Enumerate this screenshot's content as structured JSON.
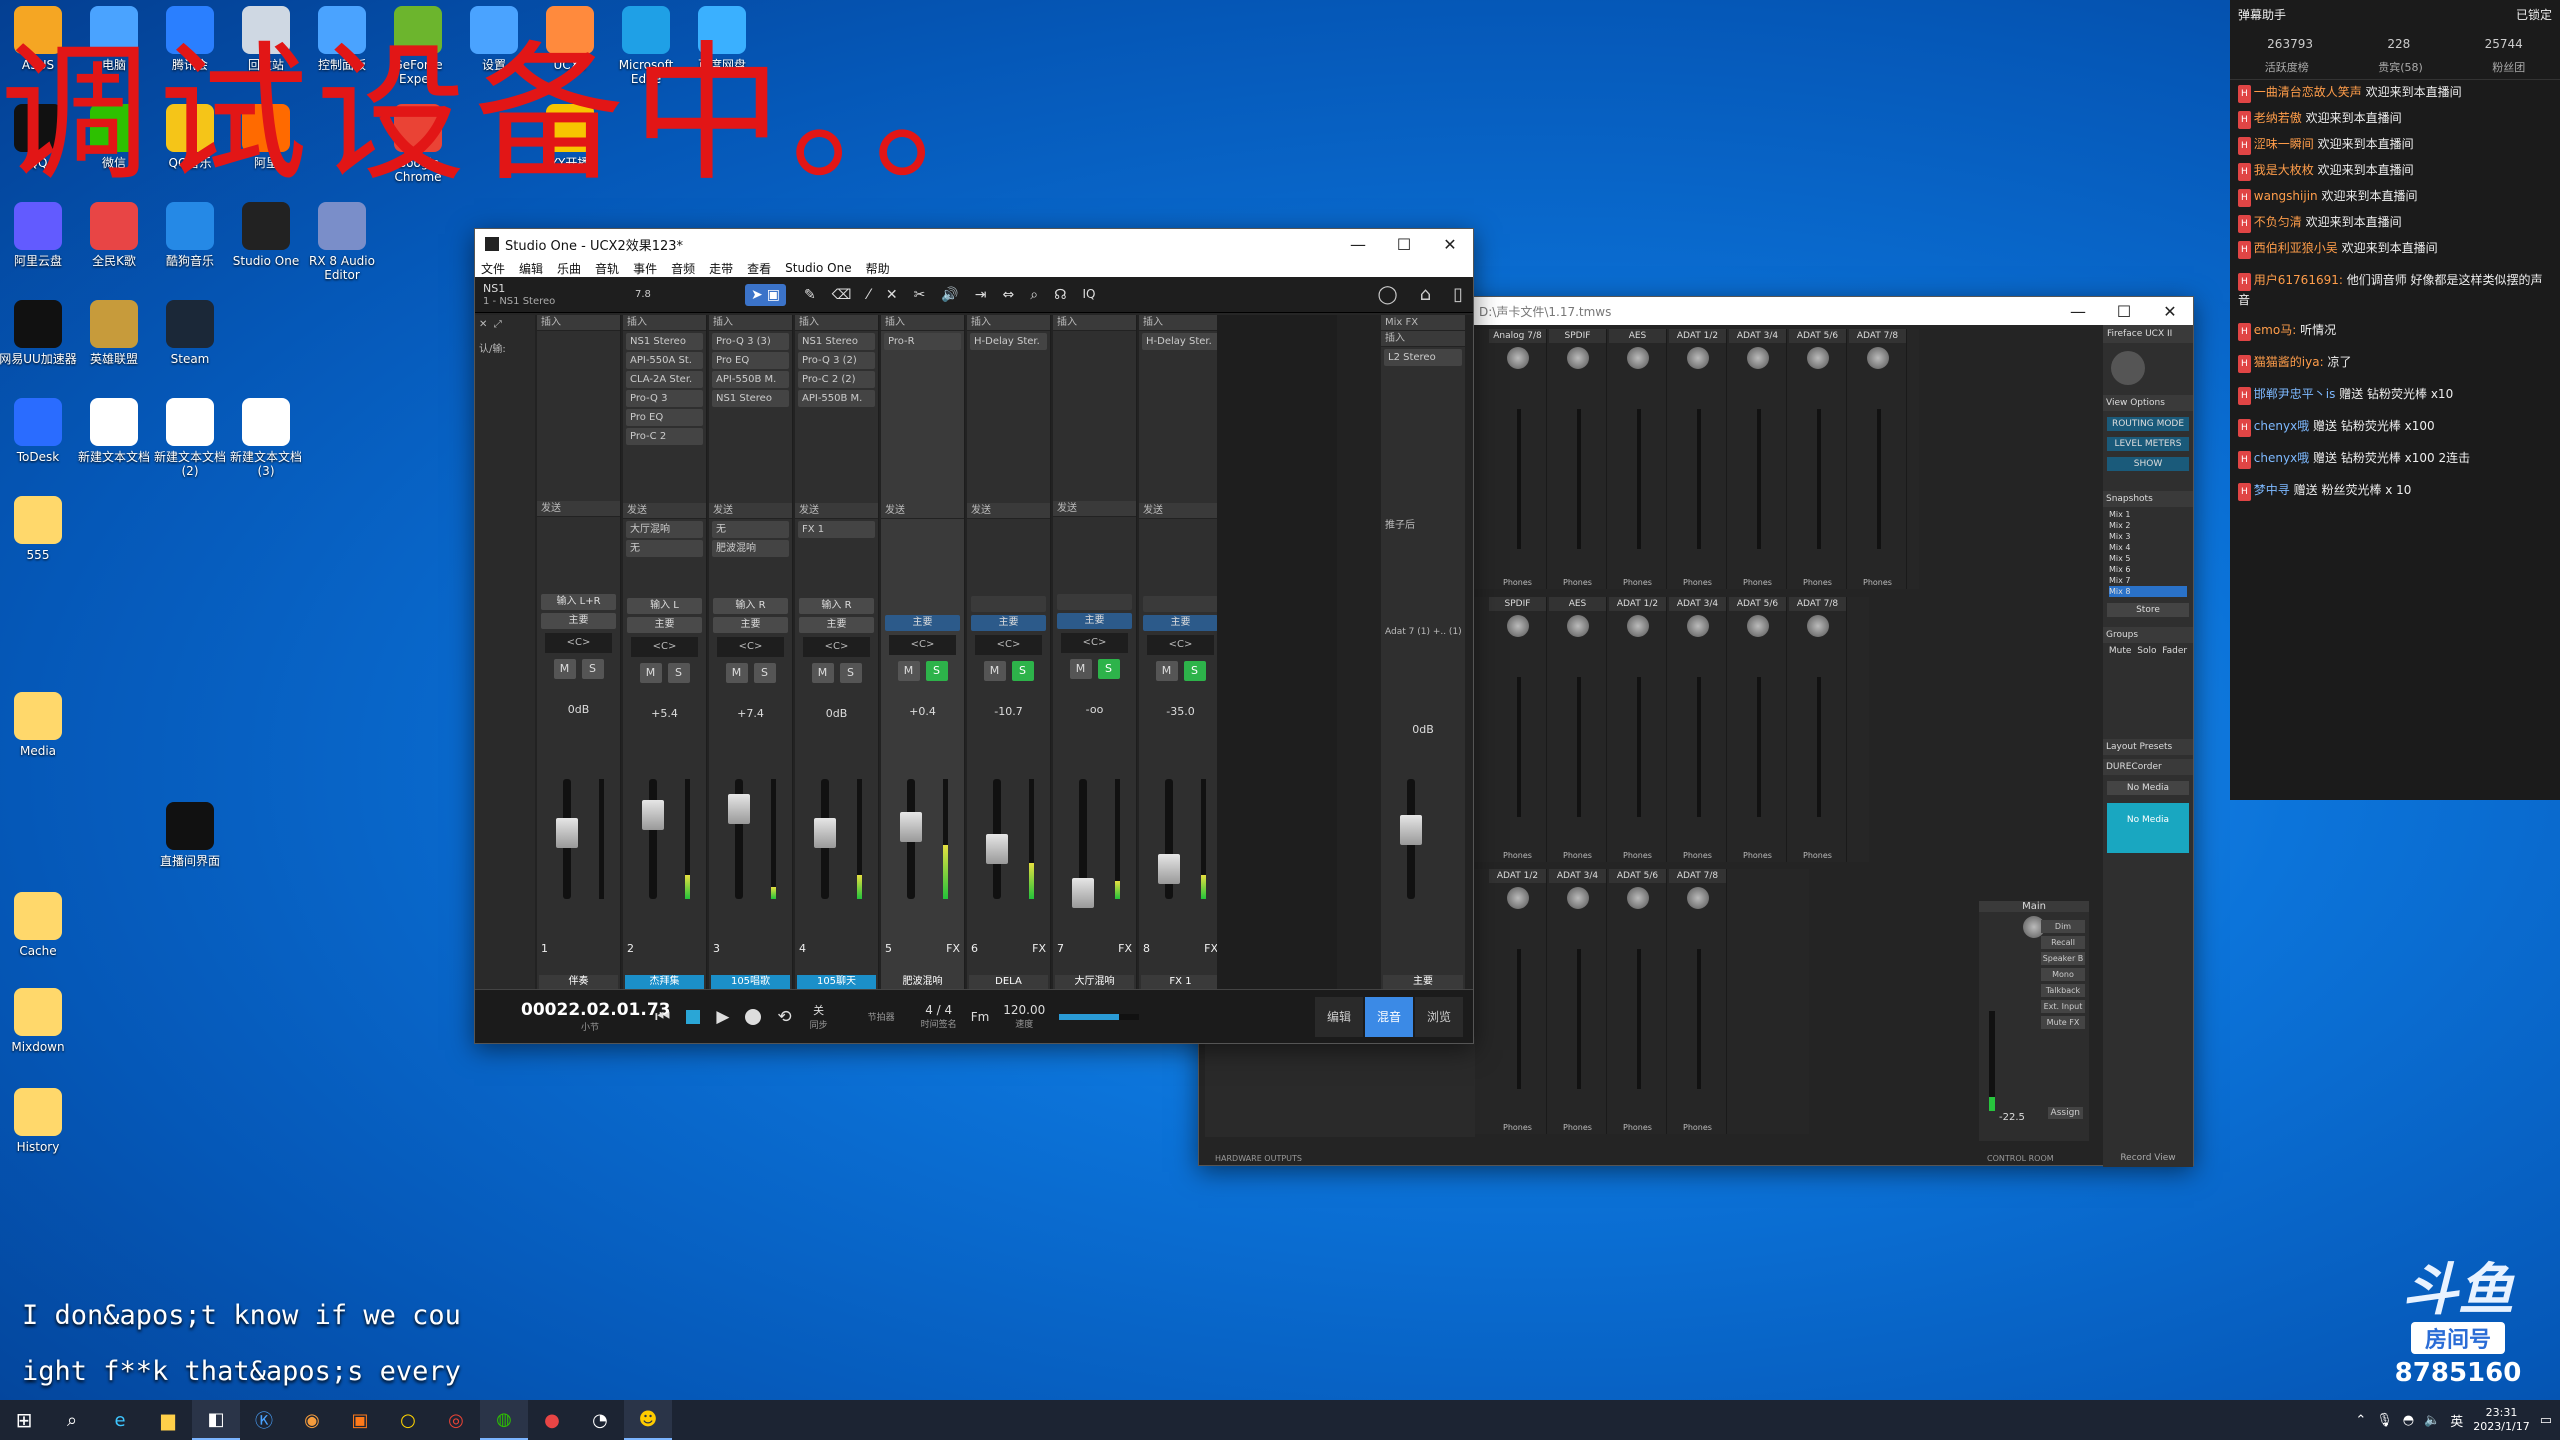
{
  "overlay_title": "调试设备中。。",
  "desktop_icons": [
    {
      "label": "ASUS",
      "icon": "person-icon",
      "color": "#f5a623"
    },
    {
      "label": "电脑",
      "icon": "computer-icon",
      "color": "#4aa3ff"
    },
    {
      "label": "腾讯会",
      "icon": "meeting-icon",
      "color": "#2a7fff"
    },
    {
      "label": "回收站",
      "icon": "recycle-bin-icon",
      "color": "#cfd8e3"
    },
    {
      "label": "控制面板",
      "icon": "control-panel-icon",
      "color": "#4aa3ff"
    },
    {
      "label": "GeForce Experi",
      "icon": "nvidia-icon",
      "color": "#6cb52d"
    },
    {
      "label": "设置",
      "icon": "gear-icon",
      "color": "#4aa3ff"
    },
    {
      "label": "UCX2",
      "icon": "app-icon",
      "color": "#ff8a3d"
    },
    {
      "label": "Microsoft Edge",
      "icon": "edge-icon",
      "color": "#1fa0e6"
    },
    {
      "label": "百度网盘",
      "icon": "cloud-icon",
      "color": "#3ab0ff"
    },
    {
      "label": "QQ",
      "icon": "qq-icon",
      "color": "#111"
    },
    {
      "label": "微信",
      "icon": "wechat-icon",
      "color": "#2dc100"
    },
    {
      "label": "QQ音乐",
      "icon": "music-icon",
      "color": "#f5c518"
    },
    {
      "label": "阿里",
      "icon": "app-icon",
      "color": "#ff6a00"
    },
    {
      "label": "Google Chrome",
      "icon": "chrome-icon",
      "color": "#ea4335"
    },
    {
      "label": "YY开播",
      "icon": "yy-icon",
      "color": "#f7c600"
    },
    {
      "label": "阿里云盘",
      "icon": "cloud-icon",
      "color": "#625bff"
    },
    {
      "label": "全民K歌",
      "icon": "karaoke-icon",
      "color": "#e84545"
    },
    {
      "label": "酷狗音乐",
      "icon": "kugou-icon",
      "color": "#2589e6"
    },
    {
      "label": "Studio One",
      "icon": "studio-one-icon",
      "color": "#222"
    },
    {
      "label": "RX 8 Audio Editor",
      "icon": "rx-icon",
      "color": "#7a8ec9"
    },
    {
      "label": "网易UU加速器",
      "icon": "uu-icon",
      "color": "#111"
    },
    {
      "label": "英雄联盟",
      "icon": "lol-icon",
      "color": "#c79b3b"
    },
    {
      "label": "Steam",
      "icon": "steam-icon",
      "color": "#1b2838"
    },
    {
      "label": "ToDesk",
      "icon": "todesk-icon",
      "color": "#2a6cff"
    },
    {
      "label": "新建文本文档",
      "icon": "file-icon",
      "color": "#ffffff"
    },
    {
      "label": "新建文本文档 (2)",
      "icon": "file-icon",
      "color": "#ffffff"
    },
    {
      "label": "新建文本文档 (3)",
      "icon": "file-icon",
      "color": "#ffffff"
    },
    {
      "label": "555",
      "icon": "folder-icon",
      "color": "#ffd86b"
    },
    {
      "label": "Media",
      "icon": "folder-icon",
      "color": "#ffd86b"
    },
    {
      "label": "直播间界面",
      "icon": "window-icon",
      "color": "#111"
    },
    {
      "label": "Cache",
      "icon": "folder-icon",
      "color": "#ffd86b"
    },
    {
      "label": "Mixdown",
      "icon": "folder-icon",
      "color": "#ffd86b"
    },
    {
      "label": "History",
      "icon": "folder-icon",
      "color": "#ffd86b"
    }
  ],
  "studio_one": {
    "title": "Studio One - UCX2效果123*",
    "menu": [
      "文件",
      "编辑",
      "乐曲",
      "音轨",
      "事件",
      "音频",
      "走带",
      "查看",
      "Studio One",
      "帮助"
    ],
    "track_name": "NS1",
    "track_sub": "1 - NS1 Stereo",
    "version_badge": "7.8",
    "tool_label": "IQ",
    "side_labels": {
      "input": "认/输:"
    },
    "insert_label": "插入",
    "send_label": "发送",
    "mixfx_label": "Mix FX",
    "channels": [
      {
        "num": "1",
        "name": "伴奏",
        "input": "输入 L+R",
        "out": "主要",
        "gain": "0dB",
        "inserts": [],
        "sends": [],
        "meter": 0,
        "fader": 0.55,
        "solo": false,
        "fx": ""
      },
      {
        "num": "2",
        "name": "杰拜集",
        "input": "输入 L",
        "out": "主要",
        "gain": "+5.4",
        "inserts": [
          "NS1 Stereo",
          "API-550A St.",
          "CLA-2A Ster.",
          "Pro-Q 3",
          "Pro EQ",
          "Pro-C 2"
        ],
        "sends": [
          "大厅混响",
          "无"
        ],
        "meter": 0.2,
        "fader": 0.7,
        "solo": false,
        "fx": ""
      },
      {
        "num": "3",
        "name": "105唱歌",
        "input": "输入 R",
        "out": "主要",
        "gain": "+7.4",
        "inserts": [
          "Pro-Q 3 (3)",
          "Pro EQ",
          "API-550B M.",
          "NS1 Stereo"
        ],
        "sends": [
          "无",
          "肥波混响"
        ],
        "meter": 0.1,
        "fader": 0.75,
        "solo": false,
        "fx": ""
      },
      {
        "num": "4",
        "name": "105聊天",
        "input": "输入 R",
        "out": "主要",
        "gain": "0dB",
        "inserts": [
          "NS1 Stereo",
          "Pro-Q 3 (2)",
          "Pro-C 2 (2)",
          "API-550B M."
        ],
        "sends": [
          "FX 1"
        ],
        "meter": 0.2,
        "fader": 0.55,
        "solo": false,
        "fx": ""
      },
      {
        "num": "5",
        "name": "肥波混响",
        "input": "",
        "out": "主要",
        "gain": "+0.4",
        "inserts": [
          "Pro-R"
        ],
        "sends": [],
        "meter": 0.45,
        "fader": 0.6,
        "solo": true,
        "fx": "FX"
      },
      {
        "num": "6",
        "name": "DELA",
        "input": "",
        "out": "主要",
        "gain": "-10.7",
        "inserts": [
          "H-Delay Ster."
        ],
        "sends": [],
        "meter": 0.3,
        "fader": 0.42,
        "solo": true,
        "fx": "FX"
      },
      {
        "num": "7",
        "name": "大厅混响",
        "input": "",
        "out": "主要",
        "gain": "-oo",
        "inserts": [],
        "sends": [],
        "meter": 0.15,
        "fader": 0.05,
        "solo": true,
        "fx": "FX"
      },
      {
        "num": "8",
        "name": "FX 1",
        "input": "",
        "out": "主要",
        "gain": "-35.0",
        "inserts": [
          "H-Delay Ster."
        ],
        "sends": [],
        "meter": 0.2,
        "fader": 0.25,
        "solo": true,
        "fx": "FX"
      }
    ],
    "main": {
      "name": "主要",
      "gain": "0dB",
      "insert": "L2 Stereo",
      "label": "Adat 7 (1) +.. (1)",
      "post": "推子后"
    },
    "time": "00022.02.01.73",
    "time_unit": "小节",
    "sync_label": "关",
    "sync_sub": "同步",
    "metronome": "节拍器",
    "signature": "4 / 4",
    "sig_sub": "时间签名",
    "key": "Fm",
    "tempo": "120.00",
    "tempo_sub": "速度",
    "tabs": [
      "编辑",
      "混音",
      "浏览"
    ],
    "active_tab": "混音"
  },
  "universal_control": {
    "title": "D:\\声卡文件\\1.17.tmws",
    "top_cols": [
      "Analog 7/8",
      "SPDIF",
      "AES",
      "ADAT 1/2",
      "ADAT 3/4",
      "ADAT 5/6",
      "ADAT 7/8"
    ],
    "mid_cols": [
      "SPDIF",
      "AES",
      "ADAT 1/2",
      "ADAT 3/4",
      "ADAT 5/6",
      "ADAT 7/8"
    ],
    "bot_cols": [
      "ADAT 1/2",
      "ADAT 3/4",
      "ADAT 5/6",
      "ADAT 7/8"
    ],
    "phones": "Phones",
    "sidebar": {
      "device": "Fireface UCX II",
      "view_options": "View Options",
      "routing_mode": "ROUTING MODE",
      "level_meters": "LEVEL METERS",
      "show": "SHOW",
      "snapshots": "Snapshots",
      "mixes": [
        "Mix 1",
        "Mix 2",
        "Mix 3",
        "Mix 4",
        "Mix 5",
        "Mix 6",
        "Mix 7",
        "Mix 8"
      ],
      "store": "Store",
      "groups": "Groups",
      "groups_head": [
        "Mute",
        "Solo",
        "Fader"
      ],
      "layout_presets": "Layout Presets",
      "durec": "DURECorder",
      "no_media": "No Media",
      "record_view": "Record View"
    },
    "main_ch": {
      "name": "Main",
      "buttons": [
        "Dim",
        "Recall",
        "Speaker B",
        "Mono",
        "Talkback",
        "Ext. Input",
        "Mute FX"
      ],
      "assign": "Assign",
      "level": "-22.5"
    },
    "footer_left": "HARDWARE OUTPUTS",
    "footer_right": "CONTROL ROOM"
  },
  "chat": {
    "header": "弹幕助手",
    "status": "已锁定",
    "stats": [
      "263793",
      "228",
      "25744"
    ],
    "tabs": [
      "活跃度榜",
      "贵宾(58)",
      "粉丝团"
    ],
    "messages": [
      {
        "nick": "一曲清台恋故人笑声",
        "text": "欢迎来到本直播间"
      },
      {
        "nick": "老纳若傲",
        "text": "欢迎来到本直播间"
      },
      {
        "nick": "涩味一瞬间",
        "text": "欢迎来到本直播间"
      },
      {
        "nick": "我是大枚枚",
        "text": "欢迎来到本直播间"
      },
      {
        "nick": "wangshijin",
        "text": "欢迎来到本直播间"
      },
      {
        "nick": "不负匀清",
        "text": "欢迎来到本直播间"
      },
      {
        "nick": "西伯利亚狼小吴",
        "text": "欢迎来到本直播间"
      },
      {
        "nick": "用户61761691:",
        "text": "他们调音师 好像都是这样类似摆的声音"
      },
      {
        "nick": "emo马:",
        "text": "听情况"
      },
      {
        "nick": "猫猫酱的iya:",
        "text": "凉了"
      },
      {
        "nick": "邯郸尹忠平丶is",
        "text": "赠送 钻粉荧光棒 x10"
      },
      {
        "nick": "chenyx哦",
        "text": "赠送 钻粉荧光棒 x100"
      },
      {
        "nick": "chenyx哦",
        "text": "赠送 钻粉荧光棒 x100 2连击"
      },
      {
        "nick": "梦中寻",
        "text": "赠送 粉丝荧光棒 x 10"
      }
    ]
  },
  "subtitles": [
    "I don&apos;t know if we cou",
    "ight f**k that&apos;s every"
  ],
  "douyu": {
    "logo": "斗鱼",
    "room_label": "房间号",
    "room_id": "8785160"
  },
  "taskbar": {
    "time": "23:31",
    "date": "2023/1/17",
    "lang": "英"
  }
}
